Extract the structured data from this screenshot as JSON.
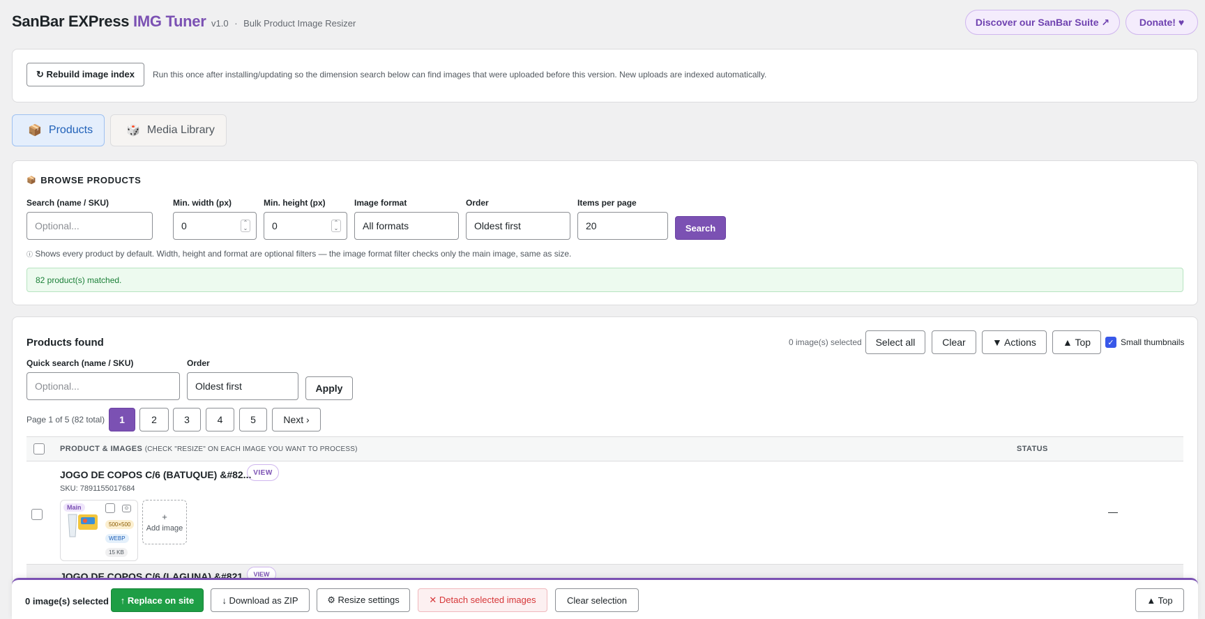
{
  "header": {
    "brand_part1": "SanBar EXPress",
    "brand_part2": "IMG Tuner",
    "version": "v1.0",
    "separator": "·",
    "subtitle": "Bulk Product Image Resizer",
    "suite_link": "Discover our SanBar Suite ↗",
    "donate": "Donate! ♥"
  },
  "rebuild": {
    "button": "↻ Rebuild image index",
    "note": "Run this once after installing/updating so the dimension search below can find images that were uploaded before this version. New uploads are indexed automatically."
  },
  "tabs": [
    {
      "icon": "📦",
      "label": "Products",
      "active": true
    },
    {
      "icon": "🎲",
      "label": "Media Library",
      "active": false
    }
  ],
  "browse": {
    "icon": "📦",
    "title": "BROWSE PRODUCTS",
    "search_label": "Search (name / SKU)",
    "search_placeholder": "Optional...",
    "min_width_label": "Min. width (px)",
    "min_width_value": "0",
    "min_height_label": "Min. height (px)",
    "min_height_value": "0",
    "format_label": "Image format",
    "format_value": "All formats",
    "order_label": "Order",
    "order_value": "Oldest first",
    "per_page_label": "Items per page",
    "per_page_value": "20",
    "search_button": "Search",
    "hint_icon": "ⓘ",
    "hint": "Shows every product by default. Width, height and format are optional filters — the image format filter checks only the main image, same as size.",
    "matched": "82 product(s) matched."
  },
  "products": {
    "title": "Products found",
    "selected_count": "0 image(s) selected",
    "select_all": "Select all",
    "clear": "Clear",
    "actions": "▼ Actions",
    "top": "▲ Top",
    "small_thumbnails": "Small thumbnails",
    "quick_search_label": "Quick search (name / SKU)",
    "quick_search_placeholder": "Optional...",
    "order_label": "Order",
    "order_value": "Oldest first",
    "apply": "Apply",
    "page_info": "Page 1 of 5 (82 total)",
    "pages": [
      "1",
      "2",
      "3",
      "4",
      "5"
    ],
    "next": "Next ›",
    "col_product": "PRODUCT & IMAGES",
    "col_product_hint": "(CHECK \"RESIZE\" ON EACH IMAGE YOU WANT TO PROCESS)",
    "col_status": "STATUS",
    "rows": [
      {
        "title": "JOGO DE COPOS C/6 (BATUQUE) &#82...",
        "view": "VIEW",
        "sku": "SKU: 7891155017684",
        "main_tag": "Main",
        "dims": "500×500",
        "format": "WEBP",
        "size": "15 KB",
        "add_image": "Add image",
        "add_plus": "+",
        "status": "—"
      },
      {
        "title": "JOGO DE COPOS C/6 (LAGUNA) &#821",
        "view": "VIEW"
      }
    ]
  },
  "bottombar": {
    "selected_count": "0 image(s) selected",
    "replace": "↑ Replace on site",
    "download": "↓ Download as ZIP",
    "resize_settings": "⚙ Resize settings",
    "detach": "✕ Detach selected images",
    "clear_selection": "Clear selection",
    "top": "▲ Top"
  },
  "colors": {
    "accent": "#7b51b3",
    "success": "#1e9e45",
    "danger": "#d63638",
    "tab_active": "#2061b8"
  }
}
